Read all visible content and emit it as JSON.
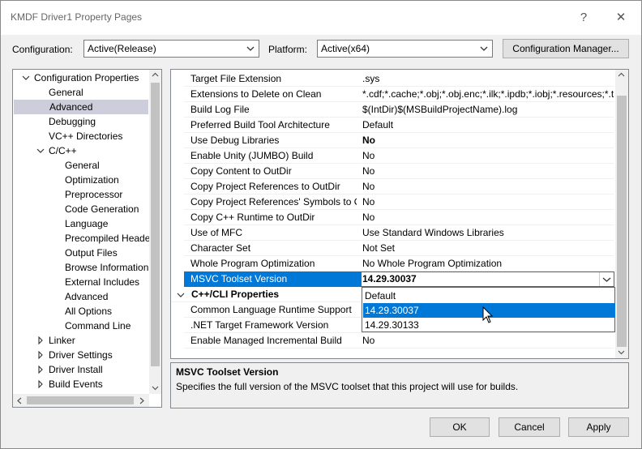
{
  "window": {
    "title": "KMDF Driver1 Property Pages",
    "help_glyph": "?",
    "close_glyph": "✕"
  },
  "top": {
    "configuration_label": "Configuration:",
    "configuration_value": "Active(Release)",
    "platform_label": "Platform:",
    "platform_value": "Active(x64)",
    "config_manager_label": "Configuration Manager..."
  },
  "tree": {
    "root_label": "Configuration Properties",
    "items": [
      {
        "label": "General"
      },
      {
        "label": "Advanced"
      },
      {
        "label": "Debugging"
      },
      {
        "label": "VC++ Directories"
      },
      {
        "label": "C/C++"
      },
      {
        "label": "General"
      },
      {
        "label": "Optimization"
      },
      {
        "label": "Preprocessor"
      },
      {
        "label": "Code Generation"
      },
      {
        "label": "Language"
      },
      {
        "label": "Precompiled Heade"
      },
      {
        "label": "Output Files"
      },
      {
        "label": "Browse Information"
      },
      {
        "label": "External Includes"
      },
      {
        "label": "Advanced"
      },
      {
        "label": "All Options"
      },
      {
        "label": "Command Line"
      },
      {
        "label": "Linker"
      },
      {
        "label": "Driver Settings"
      },
      {
        "label": "Driver Install"
      },
      {
        "label": "Build Events"
      }
    ]
  },
  "grid": {
    "rows": [
      {
        "name": "Target File Extension",
        "value": ".sys"
      },
      {
        "name": "Extensions to Delete on Clean",
        "value": "*.cdf;*.cache;*.obj;*.obj.enc;*.ilk;*.ipdb;*.iobj;*.resources;*.t"
      },
      {
        "name": "Build Log File",
        "value": "$(IntDir)$(MSBuildProjectName).log"
      },
      {
        "name": "Preferred Build Tool Architecture",
        "value": "Default"
      },
      {
        "name": "Use Debug Libraries",
        "value": "No"
      },
      {
        "name": "Enable Unity (JUMBO) Build",
        "value": "No"
      },
      {
        "name": "Copy Content to OutDir",
        "value": "No"
      },
      {
        "name": "Copy Project References to OutDir",
        "value": "No"
      },
      {
        "name": "Copy Project References' Symbols to Ou",
        "value": "No"
      },
      {
        "name": "Copy C++ Runtime to OutDir",
        "value": "No"
      },
      {
        "name": "Use of MFC",
        "value": "Use Standard Windows Libraries"
      },
      {
        "name": "Character Set",
        "value": "Not Set"
      },
      {
        "name": "Whole Program Optimization",
        "value": "No Whole Program Optimization"
      },
      {
        "name": "MSVC Toolset Version",
        "value": "14.29.30037"
      }
    ],
    "section_label": "C++/CLI Properties",
    "section_rows": [
      {
        "name": "Common Language Runtime Support",
        "value": ""
      },
      {
        "name": ".NET Target Framework Version",
        "value": ""
      },
      {
        "name": "Enable Managed Incremental Build",
        "value": "No"
      }
    ]
  },
  "dropdown": {
    "options": [
      "Default",
      "14.29.30037",
      "14.29.30133"
    ],
    "highlighted": "14.29.30037"
  },
  "description": {
    "title": "MSVC Toolset Version",
    "text": "Specifies the full version of the MSVC toolset that this project will use for builds."
  },
  "buttons": {
    "ok": "OK",
    "cancel": "Cancel",
    "apply": "Apply"
  },
  "colors": {
    "selection": "#0078d7",
    "tree_selection": "#cccedb"
  }
}
